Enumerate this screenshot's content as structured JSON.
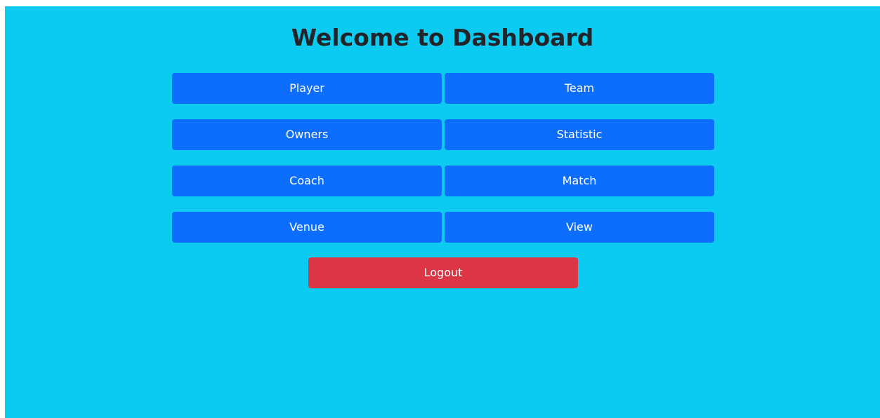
{
  "page": {
    "title": "Welcome to Dashboard"
  },
  "menu": {
    "items": [
      {
        "label": "Player"
      },
      {
        "label": "Team"
      },
      {
        "label": "Owners"
      },
      {
        "label": "Statistic"
      },
      {
        "label": "Coach"
      },
      {
        "label": "Match"
      },
      {
        "label": "Venue"
      },
      {
        "label": "View"
      }
    ]
  },
  "logout": {
    "label": "Logout"
  },
  "colors": {
    "background": "#0dcaf0",
    "primary_button": "#0d6efd",
    "danger_button": "#dc3545",
    "title_text": "#212529"
  }
}
